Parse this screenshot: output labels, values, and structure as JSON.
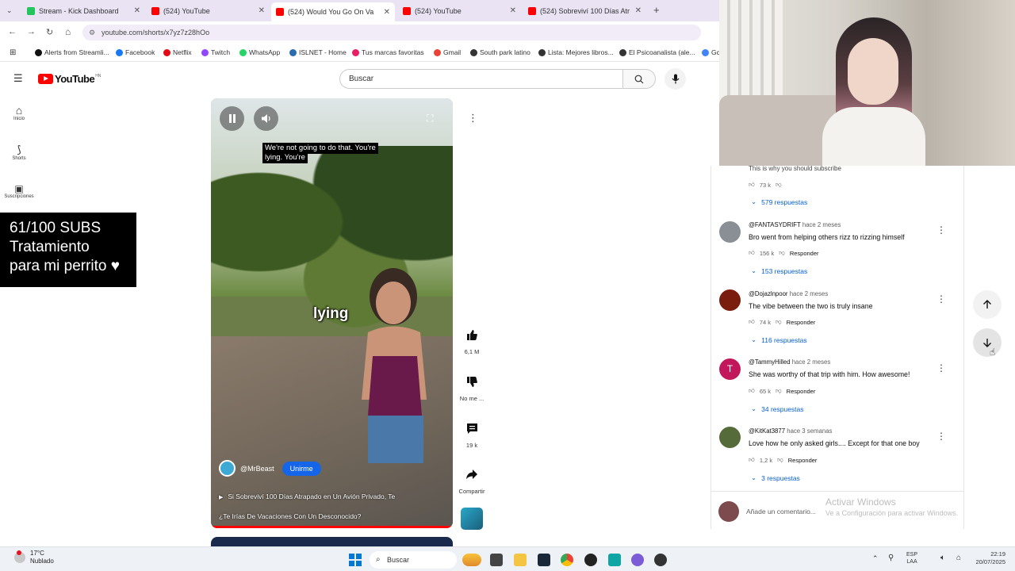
{
  "browser": {
    "tabs": [
      {
        "label": "Stream - Kick Dashboard",
        "color": "#22c55e"
      },
      {
        "label": "(524) YouTube",
        "color": "#ff0000"
      },
      {
        "label": "(524) Would You Go On Va",
        "color": "#ff0000"
      },
      {
        "label": "(524) YouTube",
        "color": "#ff0000"
      },
      {
        "label": "(524) Sobreviví 100 Días Atr",
        "color": "#ff0000"
      }
    ],
    "new_tab": "+",
    "url": "youtube.com/shorts/x7yz7z28hOo",
    "bookmarks": [
      {
        "label": "Alerts from Streamli...",
        "color": "#111111"
      },
      {
        "label": "Facebook",
        "color": "#1877f2"
      },
      {
        "label": "Netflix",
        "color": "#e50914"
      },
      {
        "label": "Twitch",
        "color": "#9146ff"
      },
      {
        "label": "WhatsApp",
        "color": "#25d366"
      },
      {
        "label": "ISLNET - Home",
        "color": "#2b6cb0"
      },
      {
        "label": "Tus marcas favoritas",
        "color": "#e91e63"
      },
      {
        "label": "Gmail",
        "color": "#ea4335"
      },
      {
        "label": "South park latino",
        "color": "#333333"
      },
      {
        "label": "Lista: Mejores libros...",
        "color": "#333333"
      },
      {
        "label": "El Psicoanalista (ale...",
        "color": "#333333"
      },
      {
        "label": "Gc",
        "color": "#4285f4"
      }
    ]
  },
  "youtube": {
    "logo_text": "YouTube",
    "logo_sup": "HN",
    "search_placeholder": "Buscar",
    "sidebar": [
      {
        "label": "Inicio"
      },
      {
        "label": "Shorts"
      },
      {
        "label": "Suscripciones"
      }
    ]
  },
  "overlay": {
    "line1": "61/100 SUBS",
    "line2": "Tratamiento",
    "line3": "para mi perrito ♥"
  },
  "video": {
    "caption_line1": "We're not going to do that. You're",
    "caption_line2": "lying. You're",
    "big_word": "lying",
    "channel": "@MrBeast",
    "subscribe_label": "Unirme",
    "title_line1": "Si Sobreviví 100 Días Atrapado en Un Avión Privado, Te",
    "title_line2": "¿Te Irías De Vacaciones Con Un Desconocido?",
    "progress": 1.0
  },
  "actions": {
    "likes": "6,1 M",
    "dislike_label": "No me ...",
    "comments": "19 k",
    "share_label": "Compartir"
  },
  "comments": {
    "top_partial_text": "This is why you should subscribe",
    "top_partial_likes": "73 k",
    "top_partial_replies": "579 respuestas",
    "items": [
      {
        "author": "@FANTASYDRIFT",
        "time": "hace 2 meses",
        "text": "Bro went from helping others rizz to rizzing himself",
        "likes": "156 k",
        "reply": "Responder",
        "replies": "153 respuestas",
        "avatar_color": "#8a8f96",
        "avatar_letter": ""
      },
      {
        "author": "@Dojazlnpoor",
        "time": "hace 2 meses",
        "text": "The vibe between the two is truly insane",
        "likes": "74 k",
        "reply": "Responder",
        "replies": "116 respuestas",
        "avatar_color": "#7a1d0e",
        "avatar_letter": ""
      },
      {
        "author": "@TammyHilled",
        "time": "hace 2 meses",
        "text": "She was worthy of that trip with him. How awesome!",
        "likes": "65 k",
        "reply": "Responder",
        "replies": "34 respuestas",
        "avatar_color": "#c2185b",
        "avatar_letter": "T"
      },
      {
        "author": "@KitKat3877",
        "time": "hace 3 semanas",
        "text": "Love how he only asked girls.... Except for that one boy",
        "likes": "1,2 k",
        "reply": "Responder",
        "replies": "3 respuestas",
        "avatar_color": "#556b3a",
        "avatar_letter": ""
      }
    ],
    "add_placeholder": "Añade un comentario..."
  },
  "windows": {
    "activate_title": "Activar Windows",
    "activate_sub": "Ve a Configuración para activar Windows."
  },
  "taskbar": {
    "weather_temp": "17°C",
    "weather_text": "Nublado",
    "search_label": "Buscar",
    "lang1": "ESP",
    "lang2": "LAA",
    "time": "22:19",
    "date": "20/07/2025"
  }
}
